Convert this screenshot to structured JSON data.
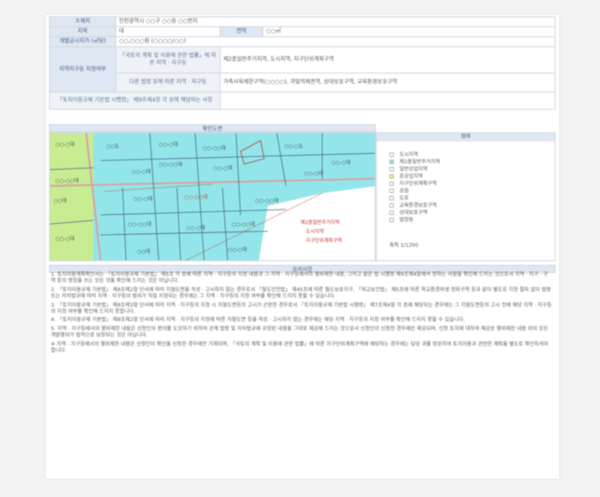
{
  "document": {
    "rows": [
      {
        "header": "소재지",
        "value": "인천광역시 ○○구 ○○동 ○○번지"
      },
      {
        "header": "지목",
        "value": "대",
        "header2": "면적",
        "value2": "○○㎡"
      },
      {
        "header": "개별공시지가 (㎡당)",
        "value": "○○,○○○원 (○○○○/○○)"
      }
    ],
    "zoning": {
      "header": "지역지구등 지정여부",
      "sub_header_1": "「국토의 계획 및 이용에 관한 법률」에 따른 지역 · 지구등",
      "value_1": "제2종일반주거지역, 도시지역, 지구단위계획구역",
      "sub_header_2": "다른 법령 등에 따른 지역 · 지구등",
      "value_2": "가축사육제한구역(○○○○), 과밀억제권역, 상대보호구역, 교육환경보호구역",
      "sub_header_3": "「토지이용규제 기본법 시행령」 제9조제4항 각 호에 해당되는 사항",
      "value_3": ""
    },
    "map_section_title": "확인도면",
    "legend_title": "범례",
    "legend_items": [
      {
        "label": "도시지역",
        "color": "#ffffff"
      },
      {
        "label": "제2종일반주거지역",
        "color": "#8fe6ea"
      },
      {
        "label": "일반상업지역",
        "color": "#ffffff"
      },
      {
        "label": "준공업지역",
        "color": "#f3e98a"
      },
      {
        "label": "지구단위계획구역",
        "color": "#ffffff"
      },
      {
        "label": "공원",
        "color": "#ffffff"
      },
      {
        "label": "도로",
        "color": "#ffffff"
      },
      {
        "label": "교육환경보호구역",
        "color": "#ffffff"
      },
      {
        "label": "상대보호구역",
        "color": "#ffffff"
      },
      {
        "label": "법정동",
        "color": "#ffffff"
      }
    ],
    "legend_scale": "축척 1/1200",
    "map_labels": [
      {
        "text": "○○-○대",
        "color": "dark"
      },
      {
        "text": "○○도",
        "color": "dark"
      },
      {
        "text": "○○-○대",
        "color": "dark"
      },
      {
        "text": "○○-○○대",
        "color": "dark"
      },
      {
        "text": "○○-○도",
        "color": "dark"
      },
      {
        "text": "○○-○대",
        "color": "dark"
      },
      {
        "text": "○○-○○대",
        "color": "dark"
      },
      {
        "text": "○○-○대",
        "color": "dark"
      },
      {
        "text": "○○-○○대",
        "color": "dark"
      },
      {
        "text": "○○-○대",
        "color": "dark"
      },
      {
        "text": "○○-○대",
        "color": "dark"
      },
      {
        "text": "○○대",
        "color": "dark"
      },
      {
        "text": "○○-○대",
        "color": "dark"
      },
      {
        "text": "○○-○○대",
        "color": "red"
      },
      {
        "text": "○○-○○대",
        "color": "dark"
      },
      {
        "text": "제2종일반주거지역",
        "color": "red"
      },
      {
        "text": "○○-○대",
        "color": "dark"
      },
      {
        "text": "○○-○○대",
        "color": "dark"
      },
      {
        "text": "○○-○대",
        "color": "dark"
      },
      {
        "text": "○○-○○대",
        "color": "dark"
      },
      {
        "text": "○○대",
        "color": "dark"
      },
      {
        "text": "도시지역",
        "color": "red"
      },
      {
        "text": "지구단위계획구역",
        "color": "red"
      },
      {
        "text": "○○-○대",
        "color": "dark"
      }
    ],
    "notes_title": "유의사항",
    "notes": [
      "1. 토지이용계획확인서는 「토지이용규제 기본법」 제5조 각 호에 따른 지역 · 지구등의 지정 내용과 그 지역 · 지구등에서의 행위제한 내용, 그리고 같은 법 시행령 제9조제4항에서 정하는 사항을 확인해 드리는 것으로서 지역 · 지구 · 구역 등의 명칭을 쓰는 모든 것을 확인해 드리는 것은 아닙니다.",
      "2. 「토지이용규제 기본법」 제8조제2항 단서에 따라 지형도면을 작성 · 고시하지 않는 경우로서 「철도안전법」 제45조에 따른 철도보호지구, 「학교보건법」 제5조에 따른 학교환경위생 정화구역 등과 같이 별도로 지정 절차 없이 법령 또는 자치법규에 따라 지역 · 지구등의 범위가 직접 지정되는 경우에는 그 지역 · 지구등의 지정 여부를 확인해 드리지 못할 수 있습니다.",
      "3. 「토지이용규제 기본법」 제8조제3항 단서에 따라 지역 · 지구등의 지정 시 지형도면등의 고시가 곤란한 경우로서 「토지이용규제 기본법 시행령」 제7조제4항 각 호에 해당되는 경우에는 그 지형도면등의 고시 전에 해당 지역 · 지구등의 지정 여부를 확인해 드리지 못합니다.",
      "4. 「토지이용규제 기본법」 제8조제2항 단서에 따라 지역 · 지구등의 지정에 따른 지형도면 등을 작성 · 고시하지 않는 경우에는 해당 지역 · 지구등의 지정 여부를 확인해 드리지 못할 수 있습니다.",
      "5. 지역 · 지구등에서의 행위제한 내용은 신청인의 편의를 도모하기 위하여 관계 법령 및 자치법규에 규정된 내용을 그대로 제공해 드리는 것으로서 신청인이 신청한 경우에만 제공되며, 신청 토지에 대하여 제공된 행위제한 내용 외의 모든 개발행위가 법적으로 보장되는 것은 아닙니다.",
      "※ 지역 · 지구등에서의 행위제한 내용은 신청인이 확인을 신청한 경우에만 기재되며, 「국토의 계획 및 이용에 관한 법률」에 따른 지구단위계획구역에 해당하는 경우에는 담당 과를 방문하여 토지이용과 관련한 계획을 별도로 확인하셔야 합니다."
    ]
  }
}
